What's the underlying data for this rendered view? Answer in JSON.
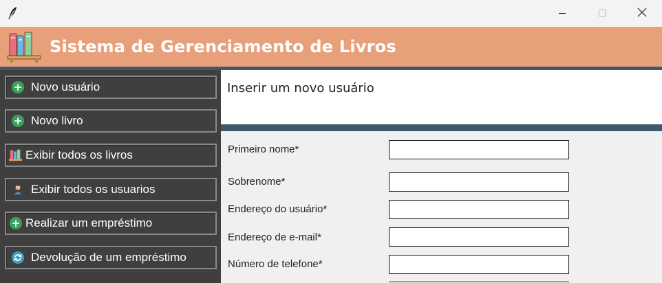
{
  "window": {
    "controls": {
      "minimize": "minimize-icon",
      "maximize": "maximize-icon",
      "close": "close-icon"
    }
  },
  "header": {
    "title": "Sistema de Gerenciamento de Livros",
    "background_color": "#e8a07a",
    "border_color": "#3d5a6c"
  },
  "sidebar": {
    "background_color": "#3f3f3f",
    "items": [
      {
        "label": "Novo usuário",
        "icon": "add-icon"
      },
      {
        "label": "Novo livro",
        "icon": "add-icon"
      },
      {
        "label": "Exibir todos os livros",
        "icon": "books-icon"
      },
      {
        "label": "Exibir todos os usuarios",
        "icon": "user-icon"
      },
      {
        "label": "Realizar um empréstimo",
        "icon": "add-icon"
      },
      {
        "label": "Devolução de um empréstimo",
        "icon": "refresh-icon"
      }
    ]
  },
  "main": {
    "heading": "Inserir um novo usuário",
    "form": {
      "fields": [
        {
          "label": "Primeiro nome*",
          "value": ""
        },
        {
          "label": "Sobrenome*",
          "value": ""
        },
        {
          "label": "Endereço do usuário*",
          "value": ""
        },
        {
          "label": "Endereço de e-mail*",
          "value": ""
        },
        {
          "label": "Número de telefone*",
          "value": ""
        }
      ]
    }
  }
}
